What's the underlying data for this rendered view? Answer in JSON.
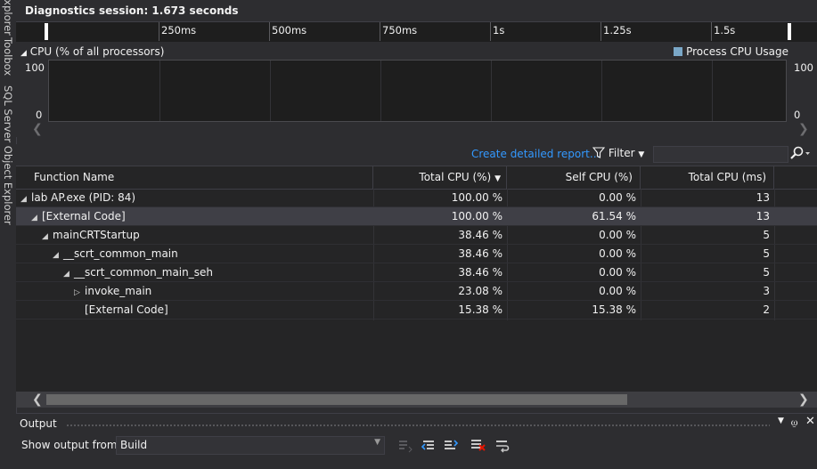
{
  "side_tabs": [
    "Explorer",
    "Toolbox",
    "SQL Server Object Explorer"
  ],
  "session": {
    "title": "Diagnostics session: 1.673 seconds"
  },
  "ruler": {
    "labels": [
      "250ms",
      "500ms",
      "750ms",
      "1s",
      "1.25s",
      "1.5s"
    ]
  },
  "cpu": {
    "title": "CPU (% of all processors)",
    "legend": "Process CPU Usage",
    "legend_color": "#7aa7c7",
    "y_max": "100",
    "y_min": "0"
  },
  "toolbar": {
    "create_report": "Create detailed report...",
    "filter_label": "Filter",
    "search_placeholder": ""
  },
  "grid": {
    "columns": [
      "Function Name",
      "Total CPU (%)",
      "Self CPU (%)",
      "Total CPU (ms)"
    ],
    "sorted_column": "Total CPU (%)",
    "rows": [
      {
        "name": "lab AP.exe (PID: 84)",
        "total_pct": "100.00 %",
        "self_pct": "0.00 %",
        "total_ms": "13",
        "expander": "expanded"
      },
      {
        "name": "[External Code]",
        "total_pct": "100.00 %",
        "self_pct": "61.54 %",
        "total_ms": "13",
        "expander": "expanded",
        "selected": true
      },
      {
        "name": "mainCRTStartup",
        "total_pct": "38.46 %",
        "self_pct": "0.00 %",
        "total_ms": "5",
        "expander": "expanded"
      },
      {
        "name": "__scrt_common_main",
        "total_pct": "38.46 %",
        "self_pct": "0.00 %",
        "total_ms": "5",
        "expander": "expanded"
      },
      {
        "name": "__scrt_common_main_seh",
        "total_pct": "38.46 %",
        "self_pct": "0.00 %",
        "total_ms": "5",
        "expander": "expanded"
      },
      {
        "name": "invoke_main",
        "total_pct": "23.08 %",
        "self_pct": "0.00 %",
        "total_ms": "3",
        "expander": "collapsed"
      },
      {
        "name": "[External Code]",
        "total_pct": "15.38 %",
        "self_pct": "15.38 %",
        "total_ms": "2",
        "expander": "none"
      }
    ]
  },
  "output": {
    "title": "Output",
    "show_from_label": "Show output from:",
    "source_value": "Build"
  },
  "colors": {
    "background": "#2d2d30",
    "grid_background": "#252526",
    "selected_row": "#3f3f46",
    "link": "#3399ff"
  }
}
